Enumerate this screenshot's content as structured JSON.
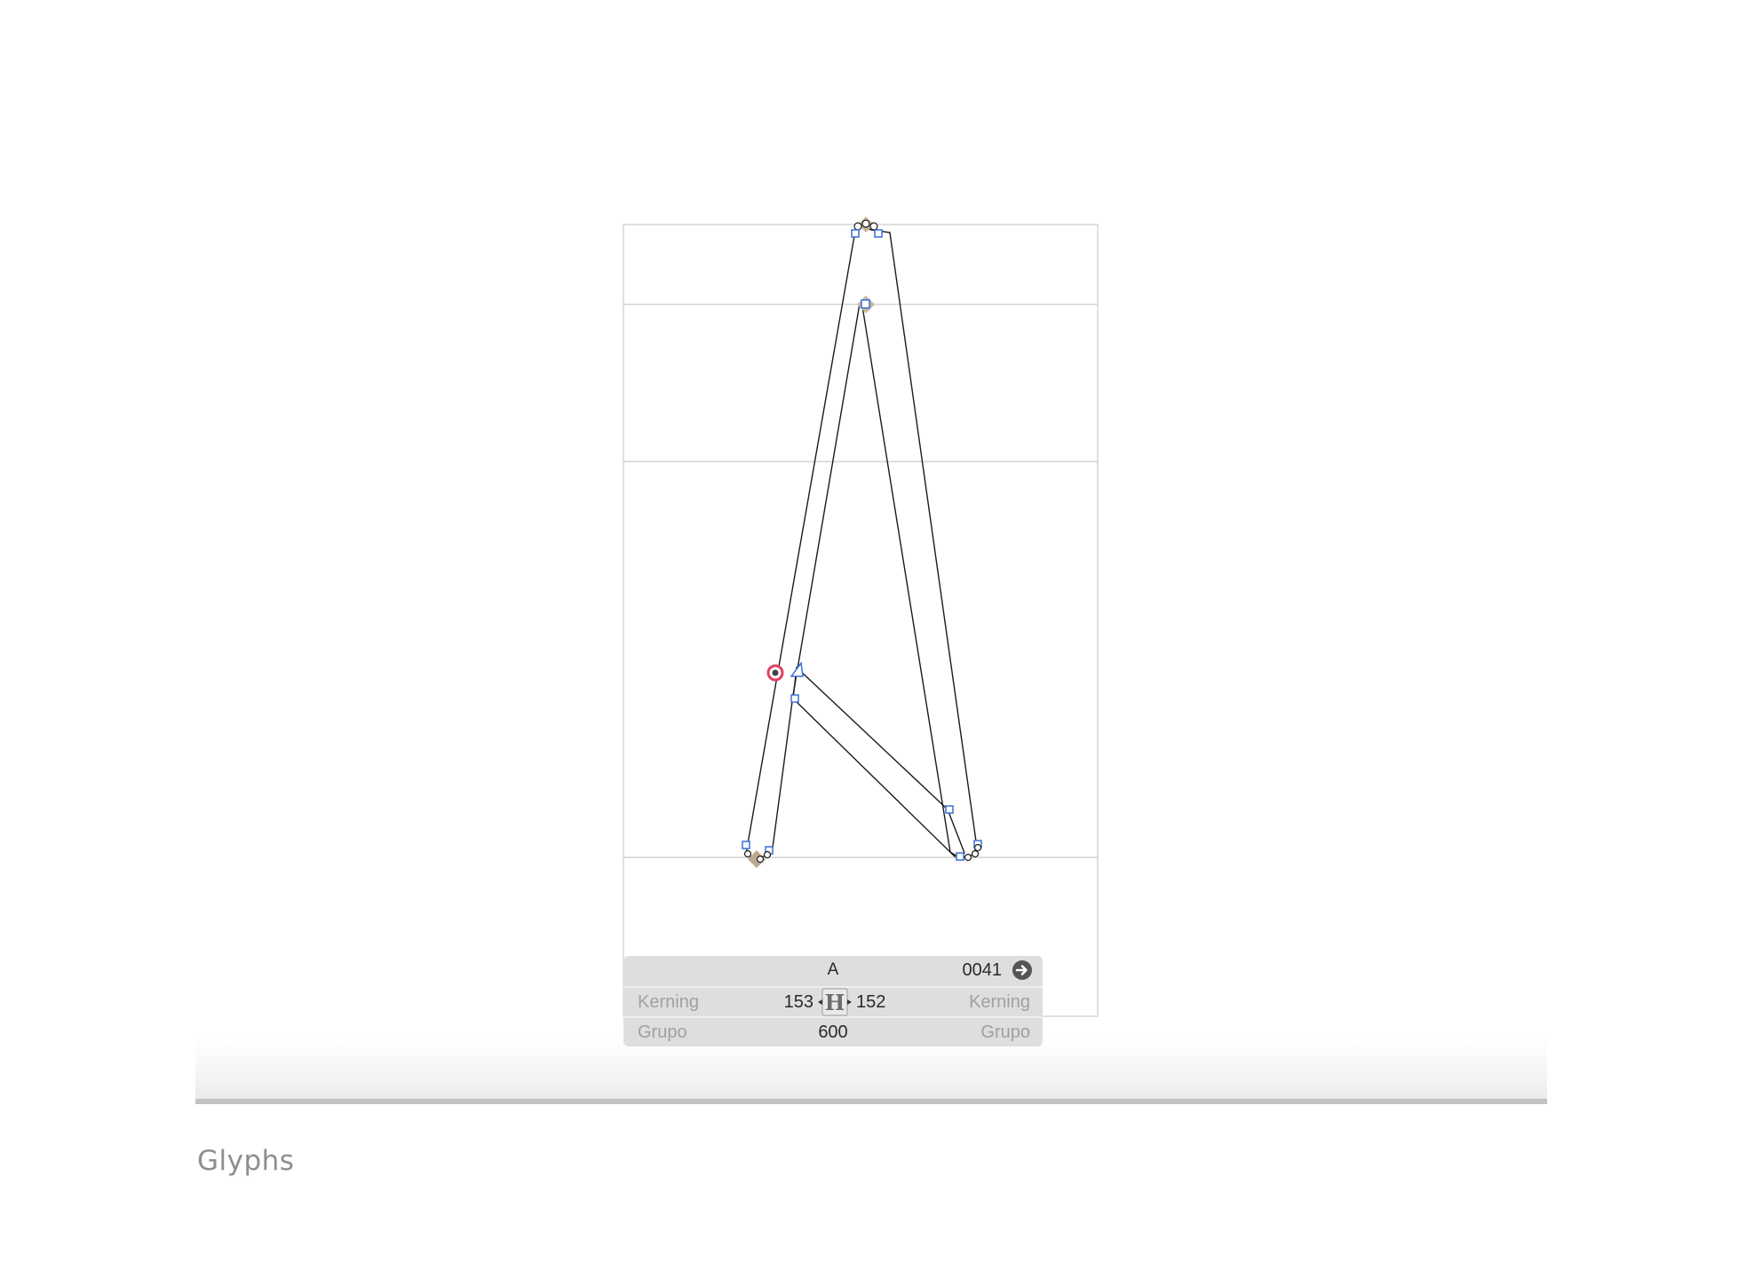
{
  "editor": {
    "glyph": "A",
    "unicode": "0041",
    "kerning_left_label": "Kerning",
    "kerning_right_label": "Kerning",
    "group_left_label": "Grupo",
    "group_right_label": "Grupo",
    "left_sidebearing": "153",
    "right_sidebearing": "152",
    "width": "600"
  },
  "icons": {
    "next_glyph": "arrow-right-circle-icon",
    "metrics": "sidebearing-metrics-icon"
  },
  "colors": {
    "node_blue": "#3a6fd8",
    "selected_node_red": "#e0405e",
    "metric_line": "#cfcfcf",
    "info_box_bg": "#dededf"
  },
  "caption": "Glyphs"
}
